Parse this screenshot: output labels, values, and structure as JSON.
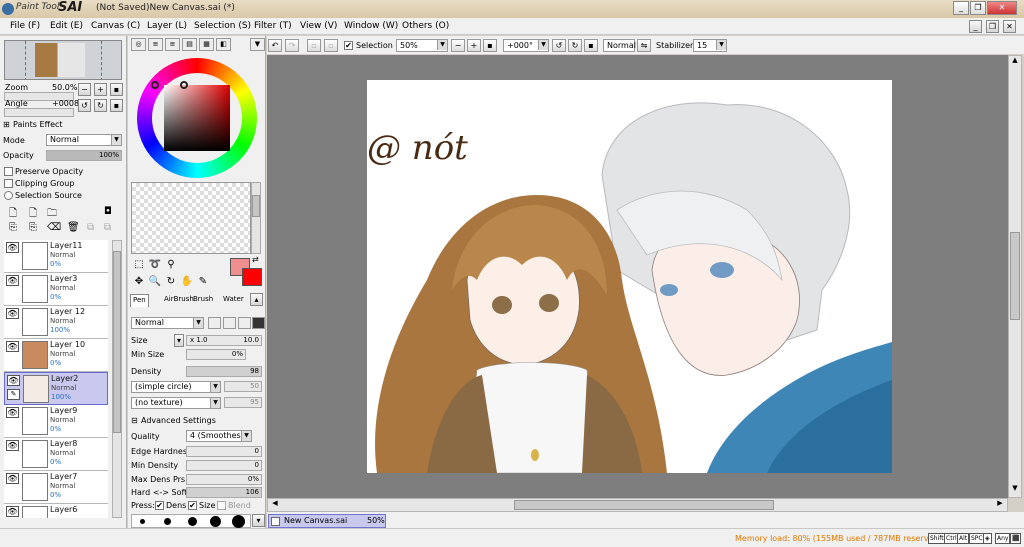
{
  "app": {
    "logo_small": "Paint Tool",
    "logo_big": "SAI",
    "window_title": "(Not Saved)New Canvas.sai (*)"
  },
  "menu": [
    "File (F)",
    "Edit (E)",
    "Canvas (C)",
    "Layer (L)",
    "Selection (S)",
    "Filter (T)",
    "View (V)",
    "Window (W)",
    "Others (O)"
  ],
  "navigator": {
    "zoom_label": "Zoom",
    "zoom_value": "50.0%",
    "angle_label": "Angle",
    "angle_value": "+0008"
  },
  "paints_effect": {
    "header": "Paints Effect",
    "mode_label": "Mode",
    "mode_value": "Normal",
    "opacity_label": "Opacity",
    "opacity_value": "100%",
    "opacity_fraction": 1.0,
    "preserve_opacity": "Preserve Opacity",
    "clipping_group": "Clipping Group",
    "selection_source": "Selection Source"
  },
  "layers": [
    {
      "name": "Layer11",
      "mode": "Normal",
      "opacity": "0%",
      "selected": false,
      "thumb": "#ffffff"
    },
    {
      "name": "Layer3",
      "mode": "Normal",
      "opacity": "0%",
      "selected": false,
      "thumb": "#ffffff"
    },
    {
      "name": "Layer 12",
      "mode": "Normal",
      "opacity": "100%",
      "selected": false,
      "thumb": "#ffffff"
    },
    {
      "name": "Layer 10",
      "mode": "Normal",
      "opacity": "0%",
      "selected": false,
      "thumb": "#c98b5e"
    },
    {
      "name": "Layer2",
      "mode": "Normal",
      "opacity": "100%",
      "selected": true,
      "thumb": "#f4ece4"
    },
    {
      "name": "Layer9",
      "mode": "Normal",
      "opacity": "0%",
      "selected": false,
      "thumb": "#ffffff"
    },
    {
      "name": "Layer8",
      "mode": "Normal",
      "opacity": "0%",
      "selected": false,
      "thumb": "#ffffff"
    },
    {
      "name": "Layer7",
      "mode": "Normal",
      "opacity": "0%",
      "selected": false,
      "thumb": "#ffffff"
    },
    {
      "name": "Layer6",
      "mode": "",
      "opacity": "",
      "selected": false,
      "thumb": "#ffffff"
    }
  ],
  "colors": {
    "primary": "#f08f8f",
    "secondary": "#ff0000",
    "accent_selection": "#c9c8ee",
    "memory_text": "#e07800"
  },
  "brush_tabs": [
    "Pen",
    "AirBrush",
    "Brush",
    "Water"
  ],
  "brush": {
    "blend_mode": "Normal",
    "size_label": "Size",
    "size_mult": "x 1.0",
    "size_value": "10.0",
    "min_size_label": "Min Size",
    "min_size_value": "0%",
    "density_label": "Density",
    "density_value": "98",
    "shape_value": "(simple circle)",
    "shape_num": "50",
    "texture_value": "(no texture)",
    "texture_num": "95",
    "advanced_label": "Advanced Settings",
    "quality_label": "Quality",
    "quality_value": "4 (Smoothest)",
    "edge_hardness_label": "Edge Hardness",
    "edge_hardness_value": "0",
    "min_density_label": "Min Density",
    "min_density_value": "0",
    "max_dens_label": "Max Dens Prs.",
    "max_dens_value": "0%",
    "hard_soft_label": "Hard <-> Soft",
    "hard_soft_value": "106",
    "press_label": "Press:",
    "press_dens": "Dens",
    "press_size": "Size",
    "press_blend": "Blend"
  },
  "toolbar": {
    "selection_label": "Selection",
    "zoom_value": "50%",
    "angle_value": "+000°",
    "mode_value": "Normal",
    "stabilizer_label": "Stabilizer",
    "stabilizer_value": "15"
  },
  "canvas": {
    "signature": "@ nót"
  },
  "doc_tab": {
    "name": "New Canvas.sai",
    "zoom": "50%"
  },
  "status": {
    "memory": "Memory load: 80% (155MB used / 787MB reserved)",
    "keys": [
      "Shift",
      "Ctrl",
      "Alt",
      "SPC",
      "◈",
      "Any",
      "⬛"
    ]
  }
}
